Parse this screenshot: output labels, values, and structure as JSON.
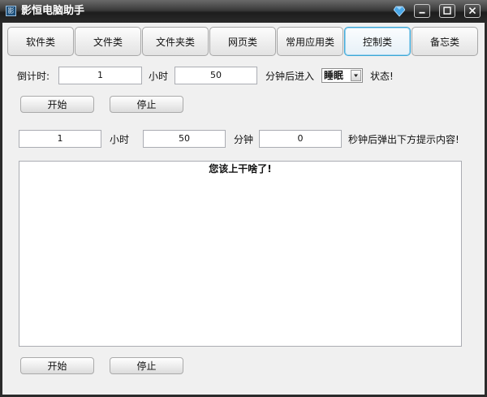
{
  "window": {
    "title": "影恒电脑助手",
    "icons": [
      "app-icon",
      "gem-icon",
      "minimize-icon",
      "maximize-icon",
      "close-icon"
    ]
  },
  "tabs": [
    {
      "label": "软件类",
      "active": false
    },
    {
      "label": "文件类",
      "active": false
    },
    {
      "label": "文件夹类",
      "active": false
    },
    {
      "label": "网页类",
      "active": false
    },
    {
      "label": "常用应用类",
      "active": false
    },
    {
      "label": "控制类",
      "active": true
    },
    {
      "label": "备忘类",
      "active": false
    }
  ],
  "countdown": {
    "label": "倒计时:",
    "hours_value": "1",
    "hours_unit": "小时",
    "minutes_value": "50",
    "minutes_suffix": "分钟后进入",
    "mode_selected": "睡眠",
    "state_suffix": "状态!",
    "start_label": "开始",
    "stop_label": "停止"
  },
  "reminder": {
    "hours_value": "1",
    "hours_unit": "小时",
    "minutes_value": "50",
    "minutes_unit": "分钟",
    "seconds_value": "0",
    "seconds_suffix": "秒钟后弹出下方提示内容!",
    "message": "您该上干啥了!",
    "start_label": "开始",
    "stop_label": "停止"
  },
  "colors": {
    "titlebar": "#2b2b2b",
    "client_bg": "#f0f0f0",
    "active_tab_border": "#3aa6d6"
  }
}
